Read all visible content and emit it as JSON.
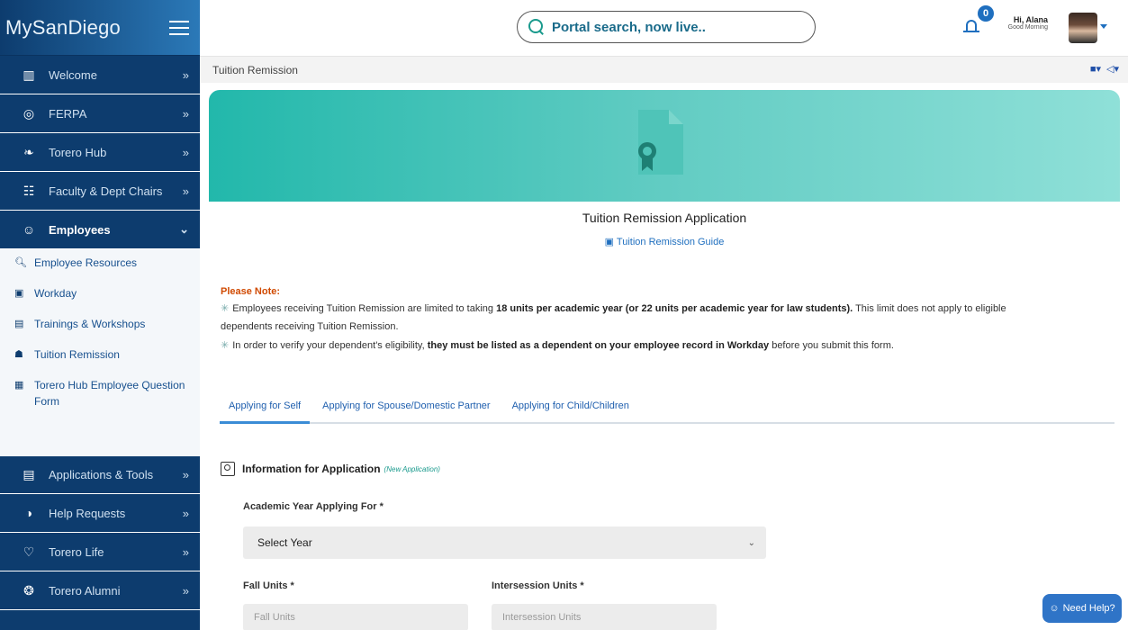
{
  "brand": {
    "title": "MySanDiego"
  },
  "sidebar": {
    "items": [
      {
        "label": "Welcome",
        "icon": "building-icon"
      },
      {
        "label": "FERPA",
        "icon": "shield-icon"
      },
      {
        "label": "Torero Hub",
        "icon": "hub-icon"
      },
      {
        "label": "Faculty & Dept Chairs",
        "icon": "group-icon"
      },
      {
        "label": "Employees",
        "icon": "users-icon",
        "expanded": true
      },
      {
        "label": "Applications & Tools",
        "icon": "toolbox-icon"
      },
      {
        "label": "Help Requests",
        "icon": "support-icon"
      },
      {
        "label": "Torero Life",
        "icon": "heart-hands-icon"
      },
      {
        "label": "Torero Alumni",
        "icon": "medal-icon"
      }
    ],
    "submenu": [
      {
        "label": "Employee Resources",
        "icon": "search-person-icon"
      },
      {
        "label": "Workday",
        "icon": "briefcase-icon"
      },
      {
        "label": "Trainings & Workshops",
        "icon": "presentation-icon"
      },
      {
        "label": "Tuition Remission",
        "icon": "tuition-icon"
      },
      {
        "label": "Torero Hub Employee Question Form",
        "icon": "form-icon"
      }
    ]
  },
  "topbar": {
    "search_placeholder": "Portal search, now live..",
    "notification_count": "0",
    "greeting_name": "Hi, Alana",
    "greeting_sub": "Good Morning"
  },
  "page": {
    "breadcrumb": "Tuition Remission",
    "app_title": "Tuition Remission Application",
    "guide_link": "Tuition Remission Guide"
  },
  "note": {
    "title": "Please Note:",
    "line1_pre": "Employees receiving Tuition Remission are limited to taking ",
    "line1_bold": "18 units per academic year (or 22 units per academic year for law students).",
    "line1_post": " This limit does not apply to eligible",
    "line2": "dependents receiving Tuition Remission.",
    "line3_pre": "In order to verify your dependent's eligibility, ",
    "line3_bold": "they must be listed as a dependent on your employee record in Workday",
    "line3_post": " before you submit this form."
  },
  "tabs": [
    {
      "label": "Applying for Self",
      "active": true
    },
    {
      "label": "Applying for Spouse/Domestic Partner",
      "active": false
    },
    {
      "label": "Applying for Child/Children",
      "active": false
    }
  ],
  "form": {
    "section_title": "Information for Application",
    "section_sub": "(New Application)",
    "academic_year_label": "Academic Year Applying For *",
    "academic_year_value": "Select Year",
    "fall_units_label": "Fall Units *",
    "fall_units_placeholder": "Fall Units",
    "intersession_label": "Intersession Units *",
    "intersession_placeholder": "Intersession Units"
  },
  "help": {
    "label": "Need Help?"
  },
  "colors": {
    "sidebar": "#0d3c6e",
    "accent": "#1f6fbf",
    "hero": "#22b8ab",
    "note": "#d04a02"
  }
}
